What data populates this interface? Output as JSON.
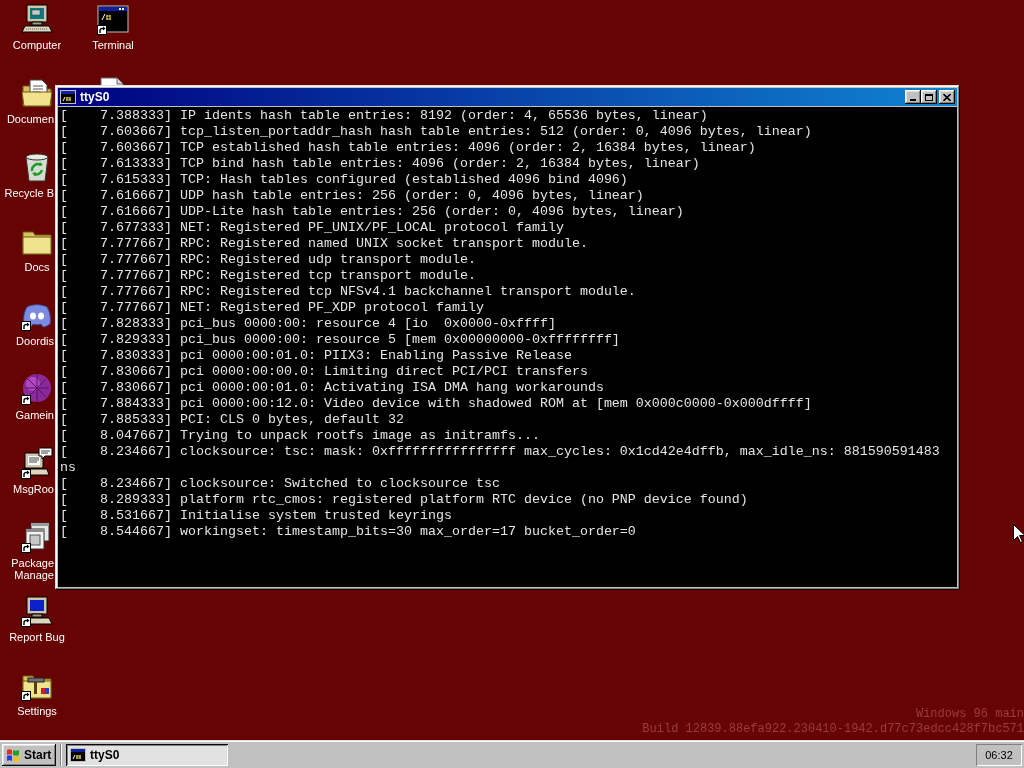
{
  "desktop": {
    "icons": [
      {
        "kind": "computer",
        "label": "Computer",
        "shortcut": false,
        "covered": false
      },
      {
        "kind": "documents",
        "label": "Documen",
        "shortcut": false,
        "covered": true
      },
      {
        "kind": "recycle_bin",
        "label": "Recycle B",
        "shortcut": false,
        "covered": true
      },
      {
        "kind": "folder",
        "label": "Docs",
        "shortcut": false,
        "covered": false
      },
      {
        "kind": "chat",
        "label": "Doordis",
        "shortcut": true,
        "covered": true
      },
      {
        "kind": "sphere",
        "label": "Gamein",
        "shortcut": true,
        "covered": true
      },
      {
        "kind": "message",
        "label": "MsgRoo",
        "shortcut": true,
        "covered": true
      },
      {
        "kind": "packages",
        "label": "Package Manage",
        "shortcut": true,
        "covered": true
      },
      {
        "kind": "report",
        "label": "Report Bug",
        "shortcut": true,
        "covered": false
      },
      {
        "kind": "settings",
        "label": "Settings",
        "shortcut": true,
        "covered": false
      },
      {
        "kind": "terminal",
        "label": "Terminal",
        "shortcut": true,
        "covered": false
      },
      {
        "kind": "document",
        "covered": true
      }
    ],
    "build_info": [
      "Windows 96 main",
      "Build 12839.88efa922.230410-1942.d77c73edcc428f7bc571"
    ]
  },
  "window": {
    "title": "ttyS0",
    "active": true,
    "lines": [
      "[    7.388333] IP idents hash table entries: 8192 (order: 4, 65536 bytes, linear)",
      "[    7.603667] tcp_listen_portaddr_hash hash table entries: 512 (order: 0, 4096 bytes, linear)",
      "[    7.603667] TCP established hash table entries: 4096 (order: 2, 16384 bytes, linear)",
      "[    7.613333] TCP bind hash table entries: 4096 (order: 2, 16384 bytes, linear)",
      "[    7.615333] TCP: Hash tables configured (established 4096 bind 4096)",
      "[    7.616667] UDP hash table entries: 256 (order: 0, 4096 bytes, linear)",
      "[    7.616667] UDP-Lite hash table entries: 256 (order: 0, 4096 bytes, linear)",
      "[    7.677333] NET: Registered PF_UNIX/PF_LOCAL protocol family",
      "[    7.777667] RPC: Registered named UNIX socket transport module.",
      "[    7.777667] RPC: Registered udp transport module.",
      "[    7.777667] RPC: Registered tcp transport module.",
      "[    7.777667] RPC: Registered tcp NFSv4.1 backchannel transport module.",
      "[    7.777667] NET: Registered PF_XDP protocol family",
      "[    7.828333] pci_bus 0000:00: resource 4 [io  0x0000-0xffff]",
      "[    7.829333] pci_bus 0000:00: resource 5 [mem 0x00000000-0xffffffff]",
      "[    7.830333] pci 0000:00:01.0: PIIX3: Enabling Passive Release",
      "[    7.830667] pci 0000:00:00.0: Limiting direct PCI/PCI transfers",
      "[    7.830667] pci 0000:00:01.0: Activating ISA DMA hang workarounds",
      "[    7.884333] pci 0000:00:12.0: Video device with shadowed ROM at [mem 0x000c0000-0x000dffff]",
      "[    7.885333] PCI: CLS 0 bytes, default 32",
      "[    8.047667] Trying to unpack rootfs image as initramfs...",
      "[    8.234667] clocksource: tsc: mask: 0xffffffffffffffff max_cycles: 0x1cd42e4dffb, max_idle_ns: 881590591483",
      "ns",
      "[    8.234667] clocksource: Switched to clocksource tsc",
      "[    8.289333] platform rtc_cmos: registered platform RTC device (no PNP device found)",
      "[    8.531667] Initialise system trusted keyrings",
      "[    8.544667] workingset: timestamp_bits=30 max_order=17 bucket_order=0"
    ]
  },
  "taskbar": {
    "start": "Start",
    "tasks": [
      {
        "label": "ttyS0",
        "selected": true
      }
    ],
    "clock": "06:32"
  }
}
